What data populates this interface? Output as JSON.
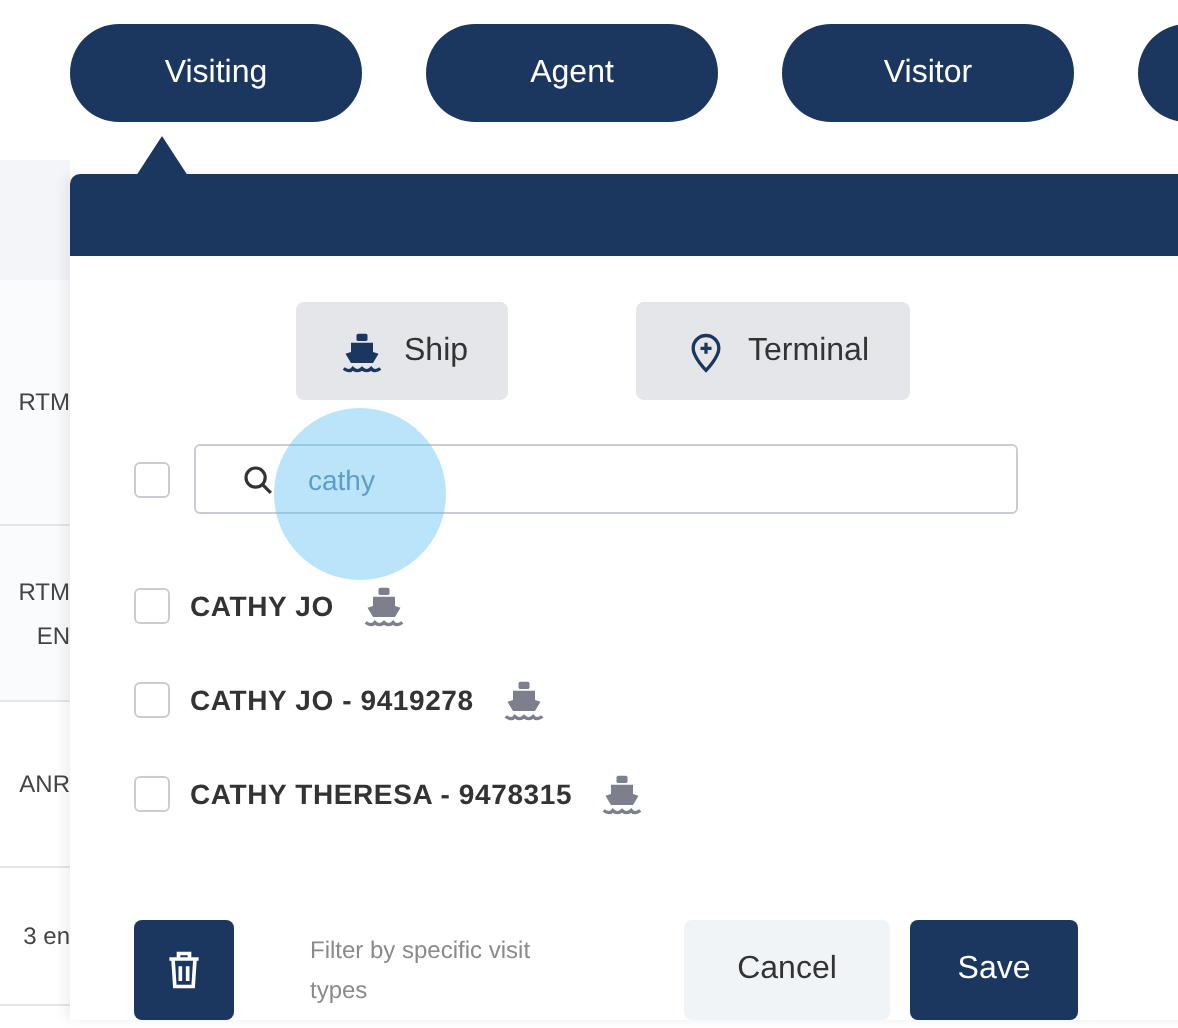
{
  "tabs": [
    {
      "label": "Visiting",
      "selected": true
    },
    {
      "label": "Agent",
      "selected": false
    },
    {
      "label": "Visitor",
      "selected": false
    },
    {
      "selected": false
    }
  ],
  "background_table": {
    "rows": [
      {
        "cells": [
          "RTM"
        ]
      },
      {
        "cells": [
          "RTM",
          "EN"
        ]
      },
      {
        "cells": [
          "ANR"
        ]
      },
      {
        "cells": [
          "3 en"
        ]
      }
    ]
  },
  "filter_panel": {
    "type_buttons": [
      {
        "kind": "ship",
        "label": "Ship"
      },
      {
        "kind": "terminal",
        "label": "Terminal"
      }
    ],
    "select_all": {
      "checked": false
    },
    "search": {
      "value": "cathy"
    },
    "results": [
      {
        "name": "CATHY JO",
        "kind": "ship",
        "checked": false
      },
      {
        "name": "CATHY JO - 9419278",
        "kind": "ship",
        "checked": false
      },
      {
        "name": "CATHY THERESA - 9478315",
        "kind": "ship",
        "checked": false
      }
    ],
    "hint": "Filter by specific visit types",
    "cancel": "Cancel",
    "save": "Save"
  },
  "touch_indicator": true
}
